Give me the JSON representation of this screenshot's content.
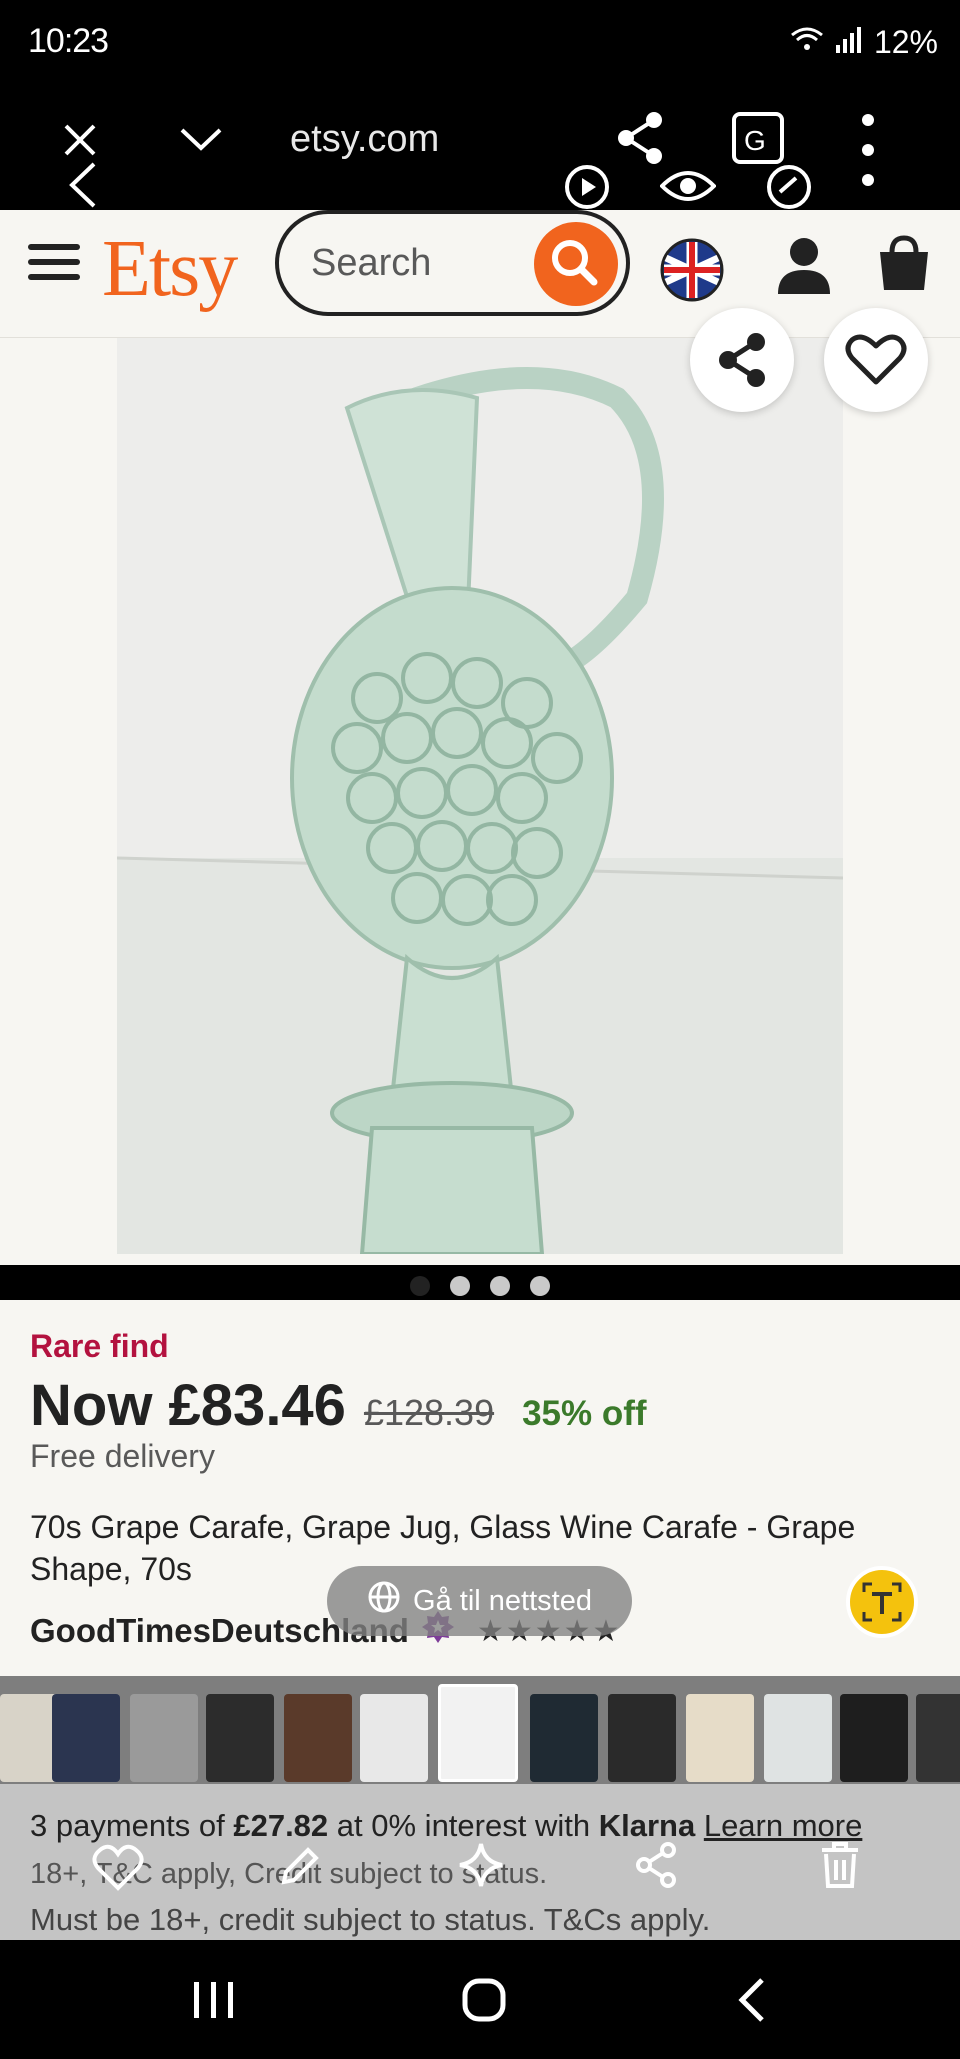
{
  "status_bar": {
    "time": "10:23",
    "battery": "12%"
  },
  "browser": {
    "url": "etsy.com"
  },
  "header": {
    "logo": "Etsy",
    "search_placeholder": "Search"
  },
  "product": {
    "badge": "Rare find",
    "price_now": "Now £83.46",
    "price_old": "£128.39",
    "discount": "35% off",
    "delivery": "Free delivery",
    "title": "70s Grape Carafe, Grape Jug, Glass Wine Carafe - Grape Shape, 70s",
    "shop": "GoodTimesDeutschland",
    "rating_stars": "★★★★★",
    "image_count": 4,
    "active_image": 1
  },
  "overlay": {
    "visit_site": "Gå til nettsted"
  },
  "klarna": {
    "prefix": "3 payments of",
    "amount": "£27.82",
    "middle": "at 0% interest with",
    "brand": "Klarna",
    "learn_more": "Learn more",
    "line2": "18+, T&C apply, Credit subject to status.",
    "line3": "Must be 18+, credit subject to status. T&Cs apply."
  },
  "colors": {
    "etsy_orange": "#f1641e",
    "rare_red": "#b3123f",
    "discount_green": "#3b7a2b"
  }
}
